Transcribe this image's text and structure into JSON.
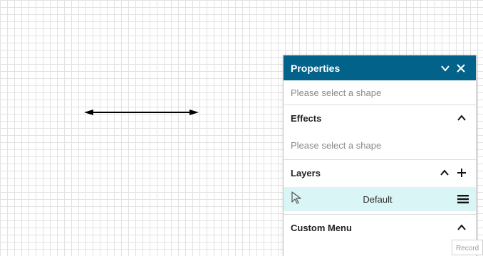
{
  "properties_panel": {
    "title": "Properties",
    "collapsed_section_text": "Please select a shape",
    "effects": {
      "title": "Effects",
      "placeholder": "Please select a shape"
    },
    "layers": {
      "title": "Layers",
      "items": [
        {
          "name": "Default"
        }
      ]
    },
    "custom_menu": {
      "title": "Custom Menu"
    }
  },
  "watermark": "Record",
  "colors": {
    "header": "#03628a",
    "layer_selected": "#d9f5f5"
  }
}
